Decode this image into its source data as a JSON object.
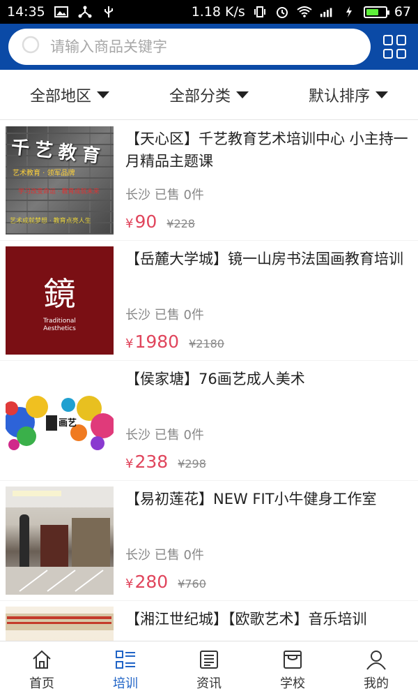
{
  "status_bar": {
    "time": "14:35",
    "speed": "1.18 K/s",
    "battery": "67",
    "battery_level": 0.67
  },
  "search": {
    "placeholder": "请输入商品关键字",
    "icon": "search-icon",
    "right_icon": "grid-menu-icon"
  },
  "filters": [
    {
      "label": "全部地区"
    },
    {
      "label": "全部分类"
    },
    {
      "label": "默认排序"
    }
  ],
  "colors": {
    "header_bg": "#0b4aa6",
    "price": "#e0455c",
    "active_tab": "#1f63c6"
  },
  "items": [
    {
      "title": "【天心区】千艺教育艺术培训中心 小主持一月精品主题课",
      "meta": "长沙 已售 0件",
      "currency": "¥",
      "price": "90",
      "old_price": "¥228",
      "thumb_text": {
        "a": "千艺教育",
        "b": "艺术教育  ·  领军品牌",
        "c": "学习改变命运 · 教育成就未来",
        "d": "艺术成就梦想 · 教育点亮人生"
      }
    },
    {
      "title": "【岳麓大学城】镜一山房书法国画教育培训",
      "meta": "长沙 已售 0件",
      "currency": "¥",
      "price": "1980",
      "old_price": "¥2180",
      "thumb_text": {
        "a": "鏡",
        "b": "Traditional\nAesthetics"
      }
    },
    {
      "title": "【侯家塘】76画艺成人美术",
      "meta": "长沙 已售 0件",
      "currency": "¥",
      "price": "238",
      "old_price": "¥298",
      "thumb_text": {
        "a": "画艺"
      }
    },
    {
      "title": "【易初莲花】NEW FIT小牛健身工作室",
      "meta": "长沙 已售 0件",
      "currency": "¥",
      "price": "280",
      "old_price": "¥760"
    },
    {
      "title": "【湘江世纪城】【欧歌艺术】音乐培训",
      "meta": "",
      "currency": "",
      "price": "",
      "old_price": ""
    }
  ],
  "tabs": [
    {
      "label": "首页",
      "icon": "home-icon",
      "active": false
    },
    {
      "label": "培训",
      "icon": "list-icon",
      "active": true
    },
    {
      "label": "资讯",
      "icon": "news-icon",
      "active": false
    },
    {
      "label": "学校",
      "icon": "store-icon",
      "active": false
    },
    {
      "label": "我的",
      "icon": "user-icon",
      "active": false
    }
  ]
}
